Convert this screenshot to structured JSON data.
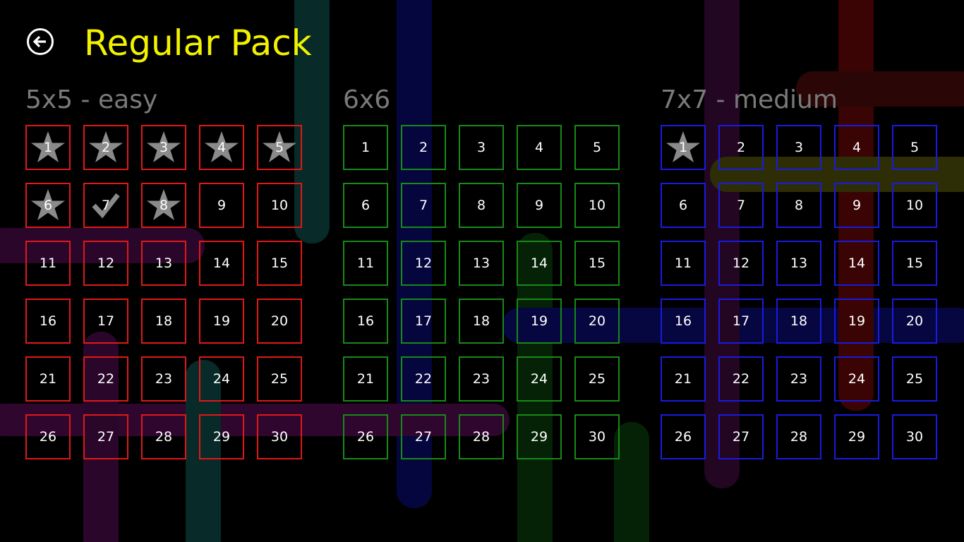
{
  "header": {
    "title": "Regular Pack",
    "back_icon": "back-arrow-icon"
  },
  "colors": {
    "title": "#f2f200",
    "section_label": "#7a7a7a",
    "star": "#8a8a8a",
    "check": "#8a8a8a"
  },
  "sections": [
    {
      "id": "5x5",
      "label": "5x5 - easy",
      "border_color": "#e01818",
      "levels": [
        {
          "n": "1",
          "status": "star"
        },
        {
          "n": "2",
          "status": "star"
        },
        {
          "n": "3",
          "status": "star"
        },
        {
          "n": "4",
          "status": "star"
        },
        {
          "n": "5",
          "status": "star"
        },
        {
          "n": "6",
          "status": "star"
        },
        {
          "n": "7",
          "status": "check"
        },
        {
          "n": "8",
          "status": "star"
        },
        {
          "n": "9",
          "status": "none"
        },
        {
          "n": "10",
          "status": "none"
        },
        {
          "n": "11",
          "status": "none"
        },
        {
          "n": "12",
          "status": "none"
        },
        {
          "n": "13",
          "status": "none"
        },
        {
          "n": "14",
          "status": "none"
        },
        {
          "n": "15",
          "status": "none"
        },
        {
          "n": "16",
          "status": "none"
        },
        {
          "n": "17",
          "status": "none"
        },
        {
          "n": "18",
          "status": "none"
        },
        {
          "n": "19",
          "status": "none"
        },
        {
          "n": "20",
          "status": "none"
        },
        {
          "n": "21",
          "status": "none"
        },
        {
          "n": "22",
          "status": "none"
        },
        {
          "n": "23",
          "status": "none"
        },
        {
          "n": "24",
          "status": "none"
        },
        {
          "n": "25",
          "status": "none"
        },
        {
          "n": "26",
          "status": "none"
        },
        {
          "n": "27",
          "status": "none"
        },
        {
          "n": "28",
          "status": "none"
        },
        {
          "n": "29",
          "status": "none"
        },
        {
          "n": "30",
          "status": "none"
        }
      ]
    },
    {
      "id": "6x6",
      "label": "6x6",
      "border_color": "#178a17",
      "levels": [
        {
          "n": "1",
          "status": "none"
        },
        {
          "n": "2",
          "status": "none"
        },
        {
          "n": "3",
          "status": "none"
        },
        {
          "n": "4",
          "status": "none"
        },
        {
          "n": "5",
          "status": "none"
        },
        {
          "n": "6",
          "status": "none"
        },
        {
          "n": "7",
          "status": "none"
        },
        {
          "n": "8",
          "status": "none"
        },
        {
          "n": "9",
          "status": "none"
        },
        {
          "n": "10",
          "status": "none"
        },
        {
          "n": "11",
          "status": "none"
        },
        {
          "n": "12",
          "status": "none"
        },
        {
          "n": "13",
          "status": "none"
        },
        {
          "n": "14",
          "status": "none"
        },
        {
          "n": "15",
          "status": "none"
        },
        {
          "n": "16",
          "status": "none"
        },
        {
          "n": "17",
          "status": "none"
        },
        {
          "n": "18",
          "status": "none"
        },
        {
          "n": "19",
          "status": "none"
        },
        {
          "n": "20",
          "status": "none"
        },
        {
          "n": "21",
          "status": "none"
        },
        {
          "n": "22",
          "status": "none"
        },
        {
          "n": "23",
          "status": "none"
        },
        {
          "n": "24",
          "status": "none"
        },
        {
          "n": "25",
          "status": "none"
        },
        {
          "n": "26",
          "status": "none"
        },
        {
          "n": "27",
          "status": "none"
        },
        {
          "n": "28",
          "status": "none"
        },
        {
          "n": "29",
          "status": "none"
        },
        {
          "n": "30",
          "status": "none"
        }
      ]
    },
    {
      "id": "7x7",
      "label": "7x7 - medium",
      "border_color": "#1a1ae0",
      "levels": [
        {
          "n": "1",
          "status": "star"
        },
        {
          "n": "2",
          "status": "none"
        },
        {
          "n": "3",
          "status": "none"
        },
        {
          "n": "4",
          "status": "none"
        },
        {
          "n": "5",
          "status": "none"
        },
        {
          "n": "6",
          "status": "none"
        },
        {
          "n": "7",
          "status": "none"
        },
        {
          "n": "8",
          "status": "none"
        },
        {
          "n": "9",
          "status": "none"
        },
        {
          "n": "10",
          "status": "none"
        },
        {
          "n": "11",
          "status": "none"
        },
        {
          "n": "12",
          "status": "none"
        },
        {
          "n": "13",
          "status": "none"
        },
        {
          "n": "14",
          "status": "none"
        },
        {
          "n": "15",
          "status": "none"
        },
        {
          "n": "16",
          "status": "none"
        },
        {
          "n": "17",
          "status": "none"
        },
        {
          "n": "18",
          "status": "none"
        },
        {
          "n": "19",
          "status": "none"
        },
        {
          "n": "20",
          "status": "none"
        },
        {
          "n": "21",
          "status": "none"
        },
        {
          "n": "22",
          "status": "none"
        },
        {
          "n": "23",
          "status": "none"
        },
        {
          "n": "24",
          "status": "none"
        },
        {
          "n": "25",
          "status": "none"
        },
        {
          "n": "26",
          "status": "none"
        },
        {
          "n": "27",
          "status": "none"
        },
        {
          "n": "28",
          "status": "none"
        },
        {
          "n": "29",
          "status": "none"
        },
        {
          "n": "30",
          "status": "none"
        }
      ]
    }
  ]
}
